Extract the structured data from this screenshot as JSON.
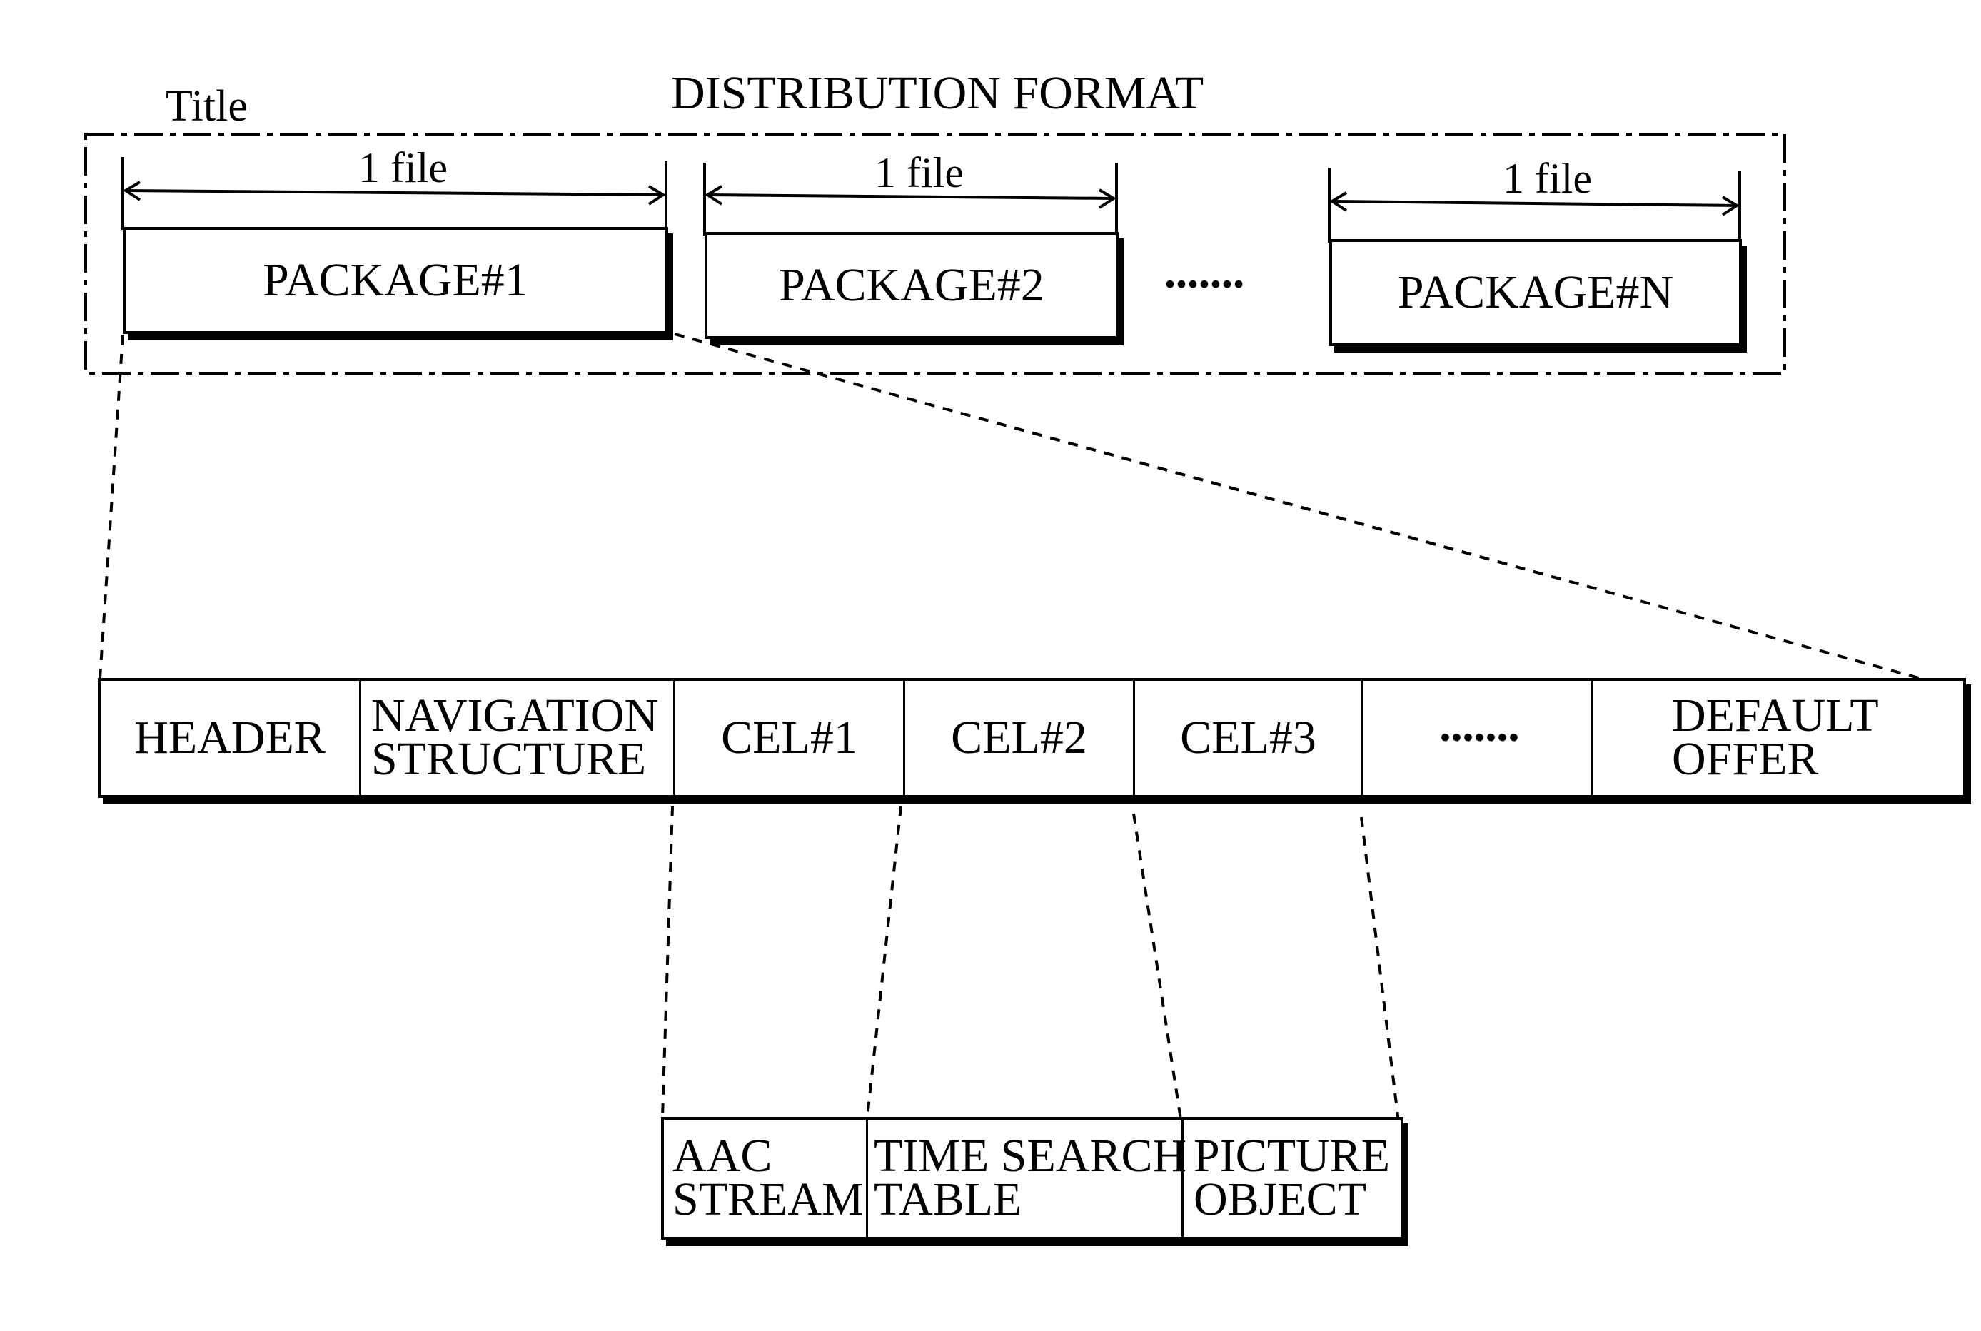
{
  "diagram": {
    "title": "DISTRIBUTION FORMAT",
    "group_label": "Title",
    "file_label": "1 file",
    "ellipsis": "·······",
    "packages": [
      {
        "label": "PACKAGE#1"
      },
      {
        "label": "PACKAGE#2"
      },
      {
        "label": "PACKAGE#N"
      }
    ],
    "package_contents": [
      {
        "label": "HEADER"
      },
      {
        "label": "NAVIGATION\nSTRUCTURE"
      },
      {
        "label": "CEL#1"
      },
      {
        "label": "CEL#2"
      },
      {
        "label": "CEL#3"
      },
      {
        "label": "·······"
      },
      {
        "label": "DEFAULT\nOFFER"
      }
    ],
    "cel_contents": [
      {
        "label": "AAC\nSTREAM"
      },
      {
        "label": "TIME SEARCH\nTABLE"
      },
      {
        "label": "PICTURE\nOBJECT"
      }
    ]
  }
}
